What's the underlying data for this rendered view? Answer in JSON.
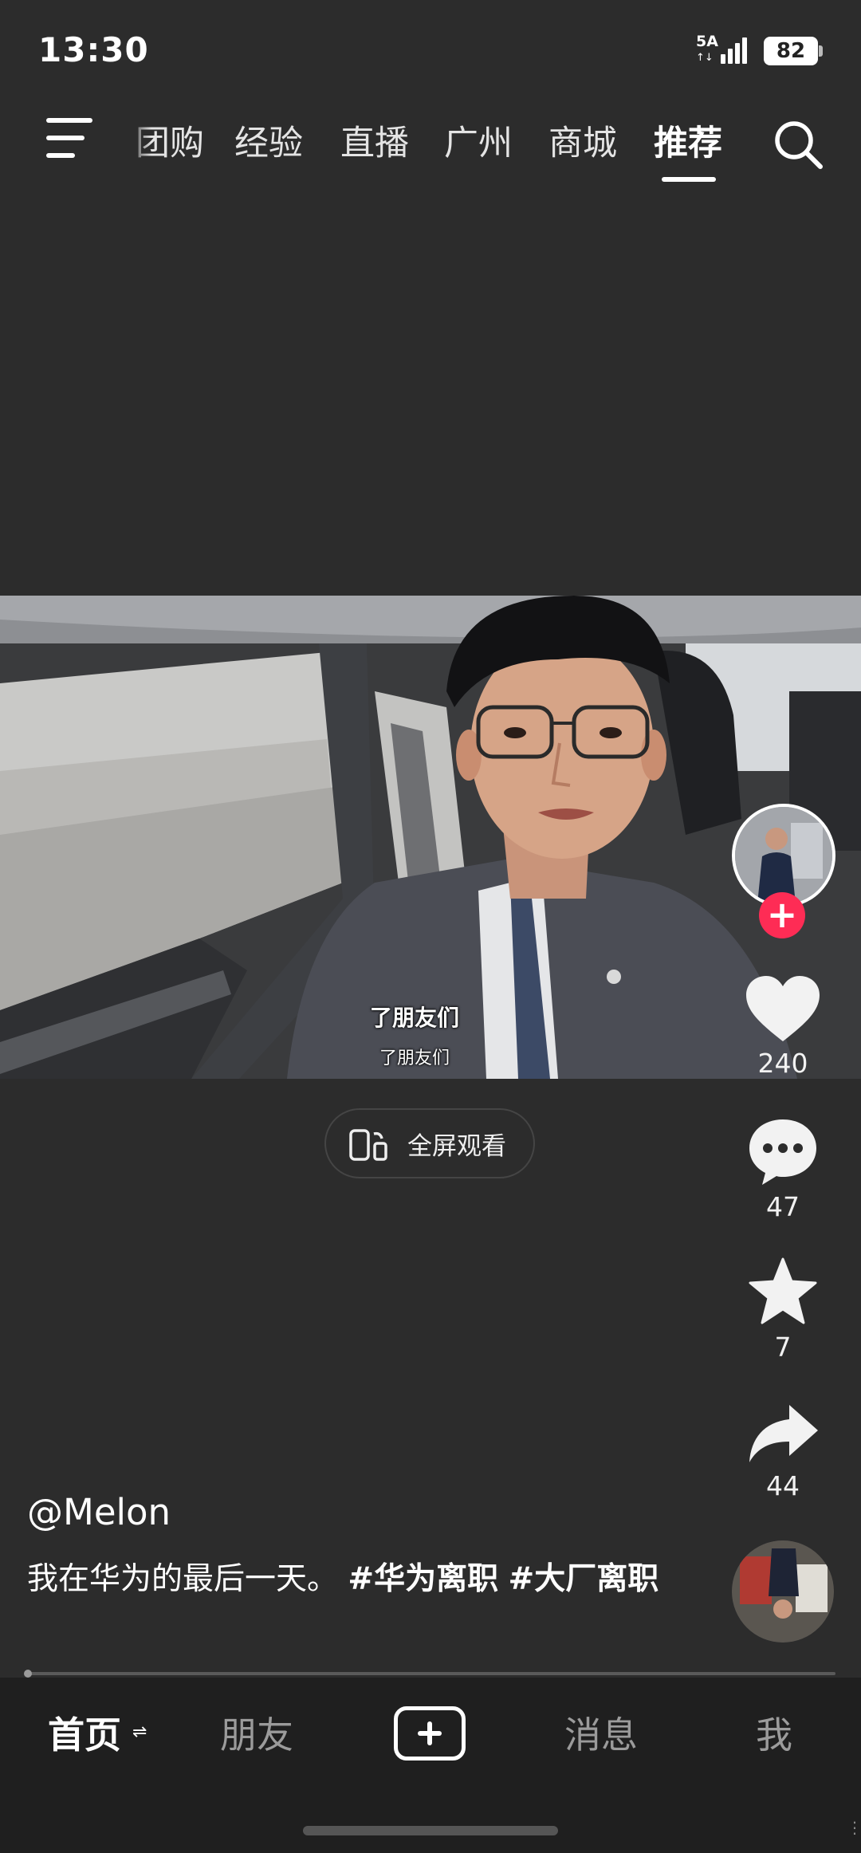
{
  "status_bar": {
    "time": "13:30",
    "network": "5A",
    "network_arrows": "↑↓",
    "battery": "82",
    "signal_bars": 4
  },
  "top_nav": {
    "tabs": [
      "团购",
      "经验",
      "直播",
      "广州",
      "商城",
      "推荐"
    ],
    "active_tab": "推荐",
    "menu_icon": "menu-icon",
    "search_icon": "search-icon"
  },
  "video": {
    "subtitle_main": "了朋友们",
    "subtitle_secondary": "了朋友们"
  },
  "fullscreen": {
    "label": "全屏观看",
    "icon": "rotate-screen-icon"
  },
  "actions": {
    "likes": "240",
    "comments": "47",
    "favorites": "7",
    "shares": "44",
    "follow_icon": "plus-icon"
  },
  "post": {
    "username": "@Melon",
    "caption_text": "我在华为的最后一天。",
    "hashtag1": "#华为离职",
    "hashtag2": "#大厂离职"
  },
  "bottom_nav": {
    "home": "首页",
    "friends": "朋友",
    "messages": "消息",
    "me": "我",
    "switch_glyph": "⇌",
    "create_icon": "plus-square-icon"
  },
  "colors": {
    "background": "#2c2c2c",
    "accent": "#fe2c55",
    "nav_background": "#1f1f1f"
  }
}
